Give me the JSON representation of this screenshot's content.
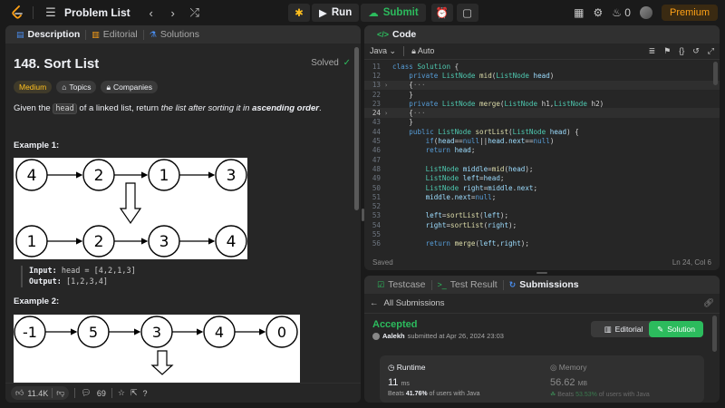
{
  "nav": {
    "problem_list": "Problem List",
    "run": "Run",
    "submit": "Submit",
    "streak": "0",
    "premium": "Premium"
  },
  "left_tabs": [
    "Description",
    "Editorial",
    "Solutions"
  ],
  "problem": {
    "title": "148. Sort List",
    "solved": "Solved",
    "difficulty": "Medium",
    "topics": "Topics",
    "companies": "Companies",
    "statement_pre": "Given the ",
    "statement_code": "head",
    "statement_mid": " of a linked list, return ",
    "statement_em": "the list after sorting it in ",
    "statement_strong": "ascending order",
    "statement_end": "."
  },
  "example1": {
    "heading": "Example 1:",
    "top_nodes": [
      "4",
      "2",
      "1",
      "3"
    ],
    "bottom_nodes": [
      "1",
      "2",
      "3",
      "4"
    ],
    "input_label": "Input:",
    "input_value": "head = [4,2,1,3]",
    "output_label": "Output:",
    "output_value": "[1,2,3,4]"
  },
  "example2": {
    "heading": "Example 2:",
    "top_nodes": [
      "-1",
      "5",
      "3",
      "4",
      "0"
    ]
  },
  "footer": {
    "likes": "11.4K",
    "comments": "69"
  },
  "code_panel": {
    "title": "Code",
    "language": "Java",
    "mode": "Auto",
    "status": "Saved",
    "cursor": "Ln 24, Col 6",
    "lines": [
      {
        "n": "11",
        "text": "class Solution {"
      },
      {
        "n": "12",
        "text": "    private ListNode mid(ListNode head)"
      },
      {
        "n": "13",
        "text": "    {···",
        "fold": true
      },
      {
        "n": "22",
        "text": "    }"
      },
      {
        "n": "23",
        "text": "    private ListNode merge(ListNode h1,ListNode h2)"
      },
      {
        "n": "24",
        "text": "    {···",
        "fold": true,
        "current": true
      },
      {
        "n": "43",
        "text": "    }"
      },
      {
        "n": "44",
        "text": "    public ListNode sortList(ListNode head) {"
      },
      {
        "n": "45",
        "text": "        if(head==null||head.next==null)"
      },
      {
        "n": "46",
        "text": "        return head;"
      },
      {
        "n": "47",
        "text": ""
      },
      {
        "n": "48",
        "text": "        ListNode middle=mid(head);"
      },
      {
        "n": "49",
        "text": "        ListNode left=head;"
      },
      {
        "n": "50",
        "text": "        ListNode right=middle.next;"
      },
      {
        "n": "51",
        "text": "        middle.next=null;"
      },
      {
        "n": "52",
        "text": ""
      },
      {
        "n": "53",
        "text": "        left=sortList(left);"
      },
      {
        "n": "54",
        "text": "        right=sortList(right);"
      },
      {
        "n": "55",
        "text": ""
      },
      {
        "n": "56",
        "text": "        return merge(left,right);"
      }
    ]
  },
  "bottom_tabs": [
    "Testcase",
    "Test Result",
    "Submissions"
  ],
  "submission": {
    "back": "All Submissions",
    "status": "Accepted",
    "user": "Aalekh",
    "submitted": "submitted at Apr 26, 2024 23:03",
    "editorial_btn": "Editorial",
    "solution_btn": "Solution",
    "runtime_label": "Runtime",
    "runtime_value": "11",
    "runtime_unit": "ms",
    "runtime_beats_pre": "Beats ",
    "runtime_beats": "41.76%",
    "runtime_beats_post": " of users with Java",
    "memory_label": "Memory",
    "memory_value": "56.62",
    "memory_unit": "MB",
    "memory_beats_pre": "Beats ",
    "memory_beats": "53.53%",
    "memory_beats_post": " of users with Java"
  },
  "colors": {
    "accent_green": "#2cbb5d",
    "medium": "#ffc01e",
    "premium": "#ffa116"
  }
}
